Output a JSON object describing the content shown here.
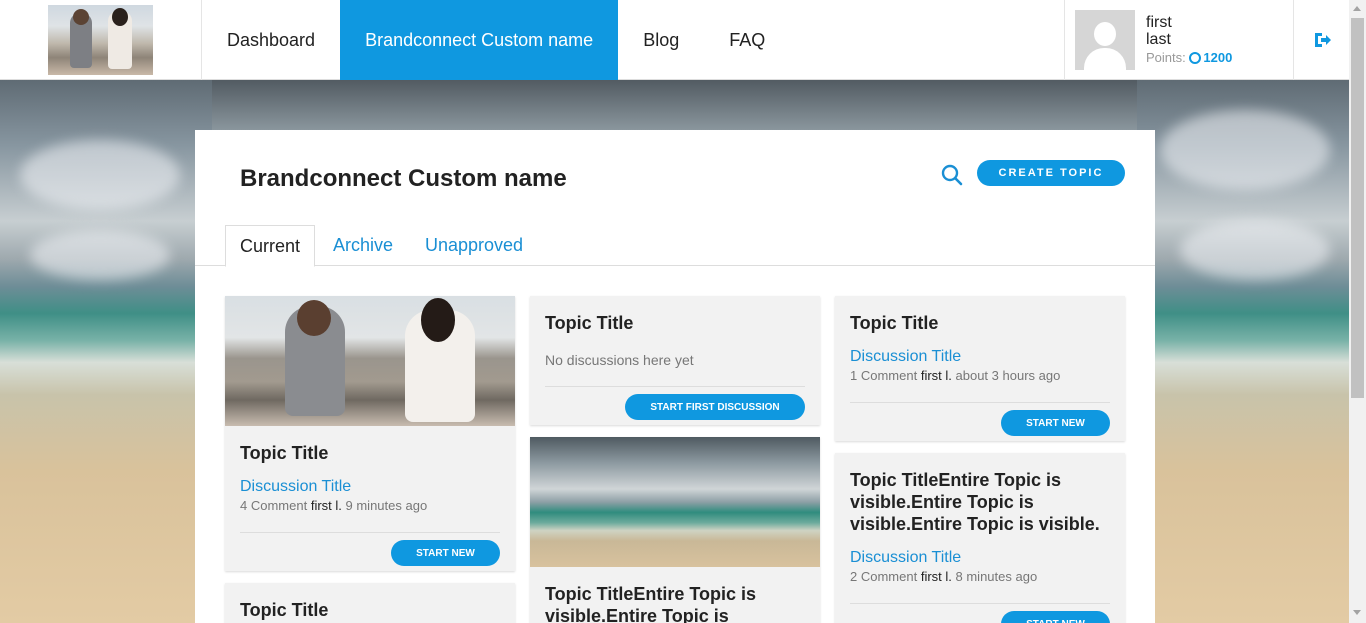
{
  "header": {
    "logo_alt": "brand logo",
    "nav": [
      {
        "label": "Dashboard"
      },
      {
        "label": "Brandconnect Custom name"
      },
      {
        "label": "Blog"
      },
      {
        "label": "FAQ"
      }
    ],
    "user": {
      "first": "first",
      "last": "last",
      "points_label": "Points:",
      "points_value": "1200"
    }
  },
  "panel": {
    "title": "Brandconnect Custom name",
    "create_label": "CREATE TOPIC",
    "tabs": [
      {
        "label": "Current"
      },
      {
        "label": "Archive"
      },
      {
        "label": "Unapproved"
      }
    ]
  },
  "cards": [
    {
      "title": "Topic Title",
      "discussion": "Discussion Title",
      "comment_count": "4 Comment",
      "user": "first l.",
      "time": "9 minutes ago",
      "button": "START NEW"
    },
    {
      "title": "Topic Title"
    },
    {
      "title": "Topic Title",
      "empty": "No discussions here yet",
      "button": "START FIRST DISCUSSION"
    },
    {
      "title": "Topic TitleEntire Topic is visible.Entire Topic is"
    },
    {
      "title": "Topic Title",
      "discussion": "Discussion Title",
      "comment_count": "1 Comment",
      "user": "first l.",
      "time": "about 3 hours ago",
      "button": "START NEW"
    },
    {
      "title": "Topic TitleEntire Topic is visible.Entire Topic is visible.Entire Topic is visible.",
      "discussion": "Discussion Title",
      "comment_count": "2 Comment",
      "user": "first l.",
      "time": "8 minutes ago",
      "button": "START NEW"
    }
  ],
  "colors": {
    "accent": "#0f98e0",
    "link": "#1a8fd4"
  },
  "icons": {
    "search": "search-icon",
    "logout": "logout-icon",
    "points": "points-icon"
  }
}
